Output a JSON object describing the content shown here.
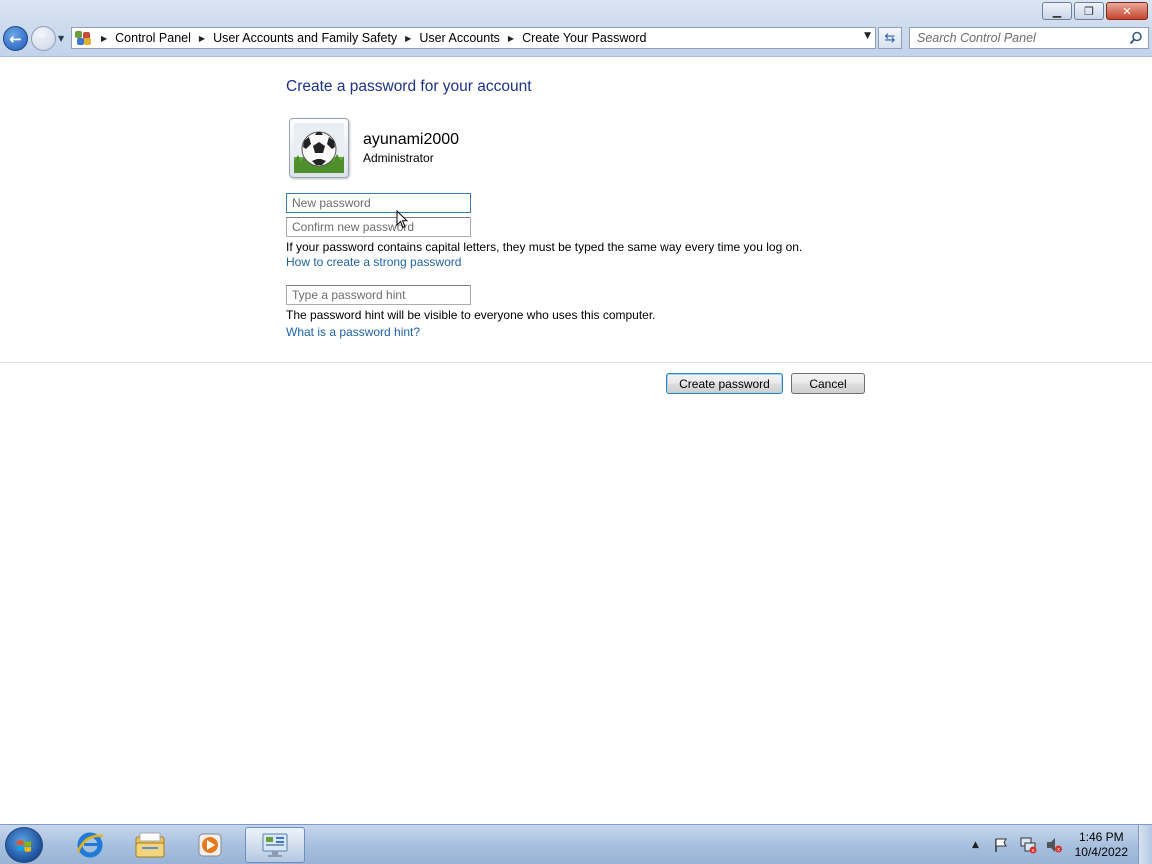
{
  "window": {
    "minimize_icon": "minimize-icon",
    "maximize_icon": "restore-icon",
    "close_icon": "close-icon"
  },
  "navigation": {
    "back_icon": "back-arrow-icon",
    "forward_icon": "forward-arrow-icon",
    "breadcrumbs": [
      "Control Panel",
      "User Accounts and Family Safety",
      "User Accounts",
      "Create Your Password"
    ],
    "search_placeholder": "Search Control Panel"
  },
  "page": {
    "title": "Create a password for your account",
    "account": {
      "username": "ayunami2000",
      "role": "Administrator",
      "avatar_icon": "soccer-ball-icon"
    },
    "fields": {
      "new_password_placeholder": "New password",
      "confirm_password_placeholder": "Confirm new password",
      "hint_placeholder": "Type a password hint"
    },
    "capital_note": "If your password contains capital letters, they must be typed the same way every time you log on.",
    "strong_password_link": "How to create a strong password",
    "hint_note": "The password hint will be visible to everyone who uses this computer.",
    "hint_link": "What is a password hint?",
    "create_button": "Create password",
    "cancel_button": "Cancel"
  },
  "taskbar": {
    "start_icon": "windows-start-icon",
    "pinned": [
      "internet-explorer-icon",
      "windows-explorer-icon",
      "media-player-icon",
      "control-panel-icon"
    ],
    "tray_icons": [
      "show-hidden-icons-arrow",
      "action-center-flag-icon",
      "network-icon",
      "volume-muted-icon"
    ],
    "time": "1:46 PM",
    "date": "10/4/2022"
  }
}
